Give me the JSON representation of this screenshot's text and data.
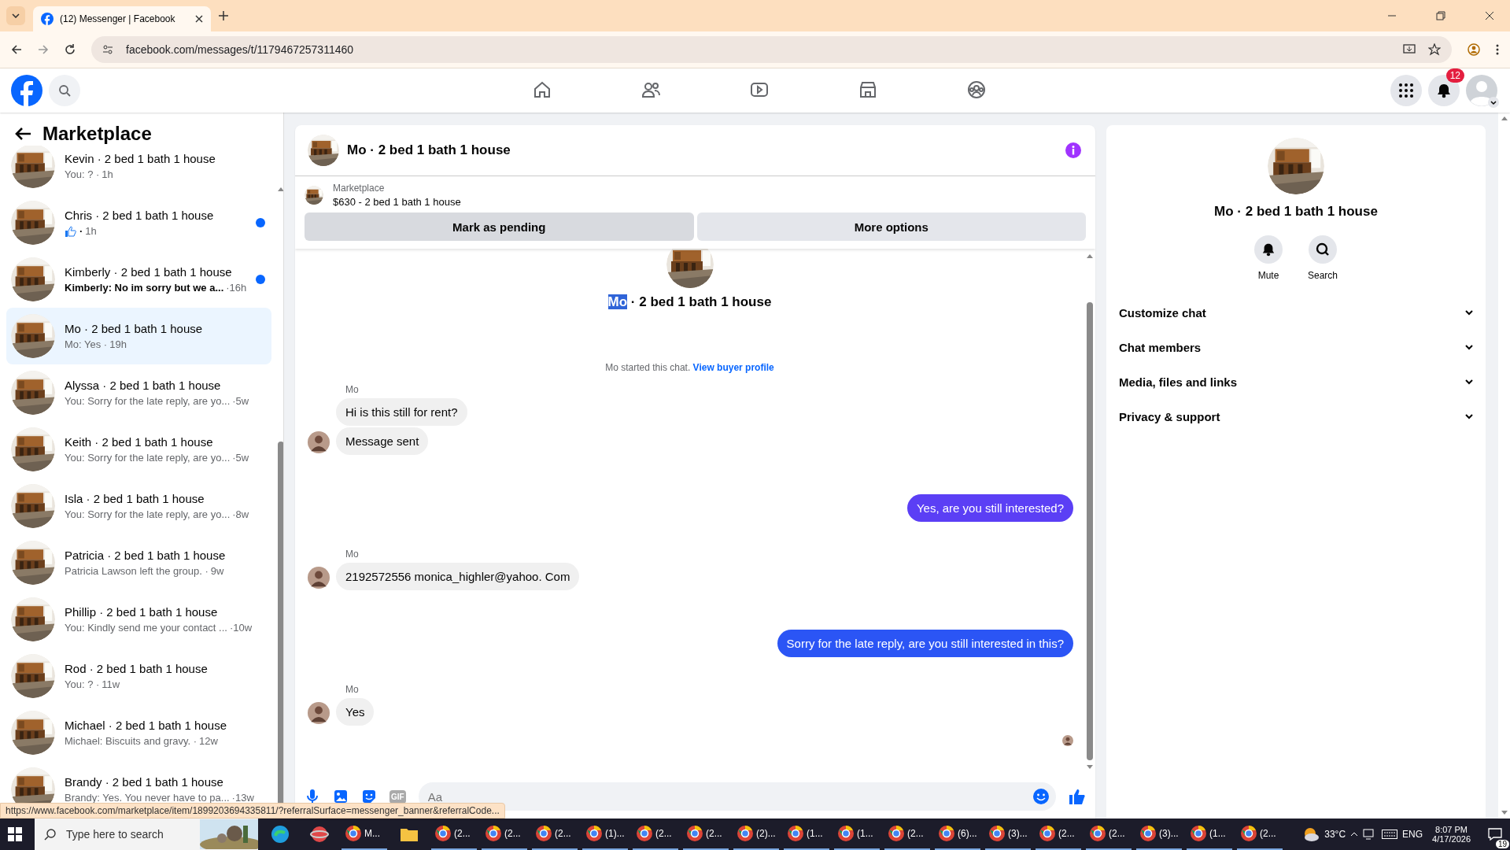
{
  "browser": {
    "tab_title": "(12) Messenger | Facebook",
    "url": "facebook.com/messages/t/1179467257311460"
  },
  "header": {
    "nav": [
      {
        "kind": "home",
        "selected": false
      },
      {
        "kind": "friends",
        "selected": false
      },
      {
        "kind": "video",
        "selected": false
      },
      {
        "kind": "marketplace",
        "selected": false
      },
      {
        "kind": "groups",
        "selected": false
      }
    ],
    "notification_count": "12"
  },
  "sidebar": {
    "title": "Marketplace",
    "conversations": [
      {
        "name": "Kevin · 2 bed 1 bath 1 house",
        "kind": "text",
        "preview": "You: ? ·",
        "time": "1h",
        "unread": false,
        "selected": false
      },
      {
        "name": "Chris · 2 bed 1 bath 1 house",
        "kind": "like",
        "preview": "·",
        "time": "1h",
        "unread": true,
        "selected": false
      },
      {
        "name": "Kimberly · 2 bed 1 bath 1 house",
        "kind": "text",
        "preview": "Kimberly: No im sorry but we a...",
        "time": "·16h",
        "unread": true,
        "selected": false
      },
      {
        "name": "Mo · 2 bed 1 bath 1 house",
        "kind": "text",
        "preview": "Mo: Yes ·",
        "time": "19h",
        "unread": false,
        "selected": true
      },
      {
        "name": "Alyssa · 2 bed 1 bath 1 house",
        "kind": "text",
        "preview": "You: Sorry for the late reply, are yo...",
        "time": "·5w",
        "unread": false,
        "selected": false
      },
      {
        "name": "Keith · 2 bed 1 bath 1 house",
        "kind": "text",
        "preview": "You: Sorry for the late reply, are yo...",
        "time": "·5w",
        "unread": false,
        "selected": false
      },
      {
        "name": "Isla · 2 bed 1 bath 1 house",
        "kind": "text",
        "preview": "You: Sorry for the late reply, are yo...",
        "time": "·8w",
        "unread": false,
        "selected": false
      },
      {
        "name": "Patricia · 2 bed 1 bath 1 house",
        "kind": "text",
        "preview": "Patricia Lawson left the group. ·",
        "time": "9w",
        "unread": false,
        "selected": false
      },
      {
        "name": "Phillip · 2 bed 1 bath 1 house",
        "kind": "text",
        "preview": "You: Kindly send me your contact ...",
        "time": "·10w",
        "unread": false,
        "selected": false
      },
      {
        "name": "Rod · 2 bed 1 bath 1 house",
        "kind": "text",
        "preview": "You: ? ·",
        "time": "11w",
        "unread": false,
        "selected": false
      },
      {
        "name": "Michael · 2 bed 1 bath 1 house",
        "kind": "text",
        "preview": "Michael: Biscuits and gravy. ·",
        "time": "12w",
        "unread": false,
        "selected": false
      },
      {
        "name": "Brandy · 2 bed 1 bath 1 house",
        "kind": "text",
        "preview": "Brandy: Yes. You never have to pa...",
        "time": "·13w",
        "unread": false,
        "selected": false
      }
    ]
  },
  "chat": {
    "title": "Mo · 2 bed 1 bath 1 house",
    "listing": {
      "source": "Marketplace",
      "summary": "$630 - 2 bed 1 bath 1 house"
    },
    "actions": [
      "Mark as pending",
      "More options"
    ],
    "thread_title": [
      {
        "text": "Mo",
        "selected": true
      },
      {
        "text": " · 2 bed 1 bath 1 house",
        "selected": false
      }
    ],
    "started": {
      "text": "Mo started this chat.",
      "link": "View buyer profile"
    },
    "groups": [
      {
        "kind": "incoming",
        "sender": "Mo",
        "messages": [
          "Hi is this still for rent?",
          "Message sent"
        ]
      },
      {
        "kind": "outgoing",
        "color": "#5b3ff5",
        "messages": [
          "Yes, are you still interested?"
        ]
      },
      {
        "kind": "incoming",
        "sender": "Mo",
        "messages": [
          "2192572556 monica_highler@yahoo. Com"
        ]
      },
      {
        "kind": "outgoing",
        "color": "#2b55f5",
        "messages": [
          "Sorry for the late reply, are you still interested in this?"
        ]
      },
      {
        "kind": "incoming",
        "sender": "Mo",
        "messages": [
          "Yes"
        ]
      }
    ],
    "composer": {
      "gif_label": "GIF",
      "placeholder": "Aa"
    }
  },
  "details": {
    "title": "Mo · 2 bed 1 bath 1 house",
    "actions": [
      {
        "kind": "mute",
        "label": "Mute"
      },
      {
        "kind": "search",
        "label": "Search"
      }
    ],
    "sections": [
      {
        "label": "Customize chat",
        "expanded": false
      },
      {
        "label": "Chat members",
        "expanded": false
      },
      {
        "label": "Media, files and links",
        "expanded": false
      },
      {
        "label": "Privacy & support",
        "expanded": false
      }
    ]
  },
  "status_url": "https://www.facebook.com/marketplace/item/1899203694335811/?referralSurface=messenger_banner&referralCode...",
  "taskbar": {
    "search_placeholder": "Type here to search",
    "apps": [
      "M...",
      "(2...",
      "(2...",
      "(2...",
      "(1)...",
      "(2...",
      "(2...",
      "(2)...",
      "(1...",
      "(1...",
      "(2...",
      "(6)...",
      "(3)...",
      "(2...",
      "(2...",
      "(3)...",
      "(1...",
      "(2..."
    ],
    "temperature": "33°C",
    "language": "ENG",
    "time": "8:07 PM",
    "date": "4/17/2026",
    "notifications": "19"
  }
}
